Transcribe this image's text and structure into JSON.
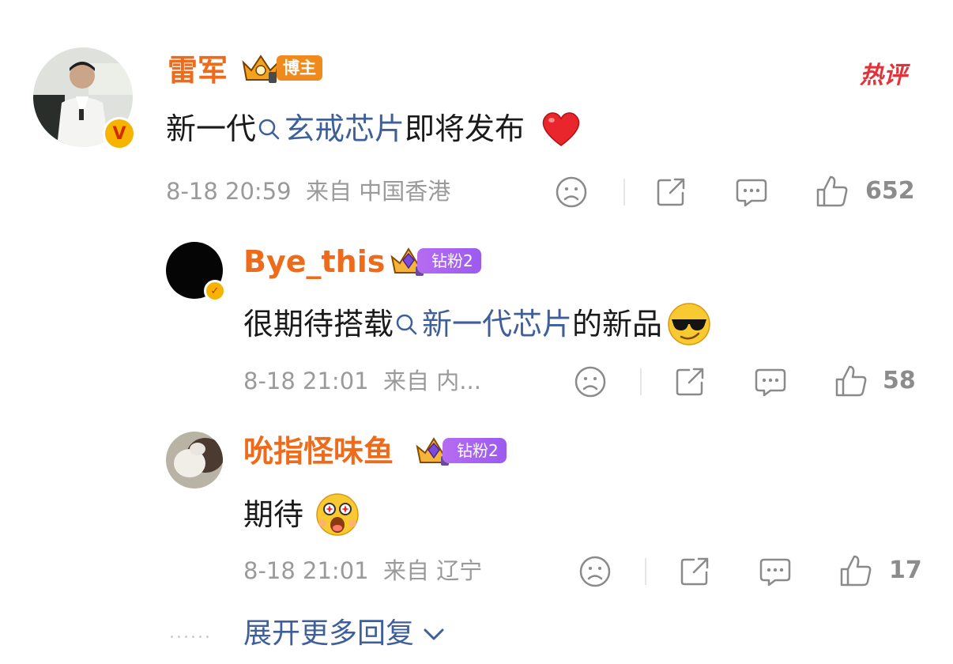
{
  "tag": {
    "hot": "热评"
  },
  "comment": {
    "author": "雷军",
    "badge": "博主",
    "text_before": "新一代",
    "topic": "玄戒芯片",
    "text_after": "即将发布",
    "emoji": "red-heart",
    "time": "8-18 20:59",
    "location": "来自 中国香港",
    "likes": "652"
  },
  "replies": [
    {
      "author": "Bye_this",
      "fan_badge": "钻粉2",
      "text_before": "很期待搭载",
      "topic": "新一代芯片",
      "text_after": "的新品",
      "emoji": "sunglasses-face",
      "time": "8-18 21:01",
      "location": "来自 内...",
      "likes": "58"
    },
    {
      "author": "吮指怪味鱼",
      "fan_badge": "钻粉2",
      "text": "期待",
      "emoji": "starstruck-face",
      "time": "8-18 21:01",
      "location": "来自 辽宁",
      "likes": "17"
    }
  ],
  "expand": {
    "dots": "......",
    "label": "展开更多回复"
  },
  "colors": {
    "name": "#ee6b1c",
    "topic": "#3f5f9a",
    "meta": "#9a9a9a",
    "hot": "#e5323a",
    "fan_badge": "#a862f0"
  }
}
